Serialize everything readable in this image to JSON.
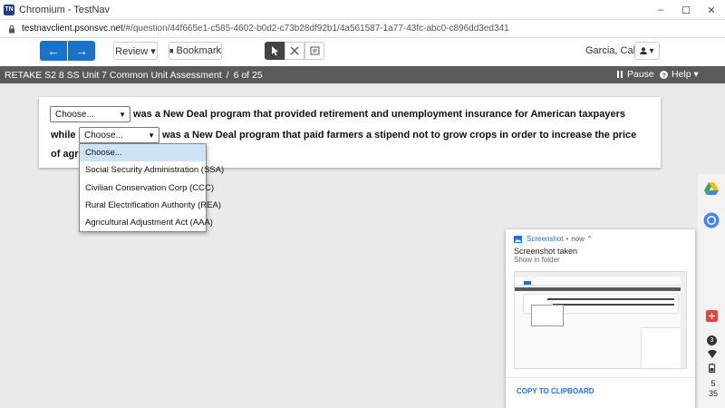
{
  "window": {
    "title": "Chromium - TestNav",
    "app_icon_text": "TN",
    "minimize": "–",
    "maximize": "☐",
    "close": "✕"
  },
  "urlbar": {
    "host": "testnavclient.psonsvc.net",
    "path": "/#/question/44f665e1-c585-4602-b0d2-c73b28df92b1/4a561587-1a77-43fc-abc0-c896dd3ed341"
  },
  "toolbar": {
    "prev_icon": "←",
    "next_icon": "→",
    "review_label": "Review ▾",
    "bookmark_label": "Bookmark",
    "user_name": "Garcia, Caleb",
    "user_menu": "▾"
  },
  "testbar": {
    "test_name": "RETAKE S2 8 SS Unit 7 Common Unit Assessment",
    "separator": "/",
    "progress": "6 of 25",
    "pause_label": "Pause",
    "help_label": "Help ▾"
  },
  "question": {
    "select1_value": "Choose...",
    "line1_text": "was a New Deal program that provided retirement and unemployment insurance for American taxpayers",
    "line2_prefix": "while",
    "select2_value": "Choose...",
    "line2_text": "was a New Deal program that paid farmers a stipend not to grow crops in order to increase the price",
    "line3_text": "of agr"
  },
  "dropdown": {
    "options": [
      "Choose...",
      "Social Security Administration (SSA)",
      "Civilian Conservation Corp (CCC)",
      "Rural Electrification Authority (REA)",
      "Agricultural Adjustment Act (AAA)"
    ]
  },
  "notification": {
    "source": "Screenshot",
    "time": "now",
    "message": "Screenshot taken",
    "action": "Show in folder",
    "copy_button": "COPY TO CLIPBOARD"
  },
  "shelf": {
    "badge_count": "3",
    "time_line1": "5",
    "time_line2": "35"
  },
  "colors": {
    "accent": "#1a73c8",
    "testbar": "#5a5a5a",
    "selected_option": "#cfe3f7"
  }
}
